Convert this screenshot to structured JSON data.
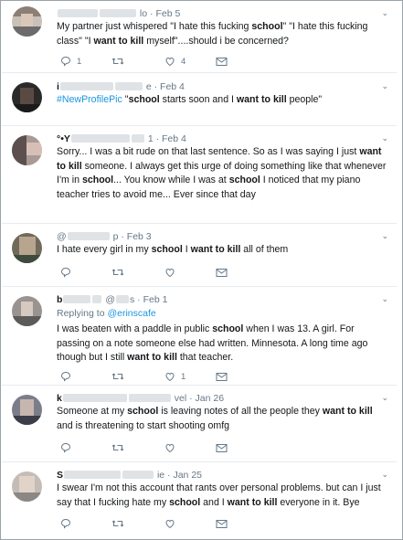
{
  "tweets": [
    {
      "handle_tail": "lo",
      "date": "Feb 5",
      "segments": [
        {
          "t": "My partner just whispered \"I hate this fucking "
        },
        {
          "t": "school",
          "b": true
        },
        {
          "t": "\" \"I hate this fucking class\" \"I "
        },
        {
          "t": "want to kill",
          "b": true
        },
        {
          "t": " myself\"....should i be concerned?"
        }
      ],
      "reply_count": "1",
      "retweet_count": "",
      "like_count": "4"
    },
    {
      "handle_head": "i",
      "handle_tail": "e",
      "date": "Feb 4",
      "segments": [
        {
          "t": "#NewProfilePic",
          "h": true
        },
        {
          "t": " \""
        },
        {
          "t": "school",
          "b": true
        },
        {
          "t": " starts soon and I "
        },
        {
          "t": "want to kill",
          "b": true
        },
        {
          "t": " people\""
        }
      ],
      "reply_count": "",
      "retweet_count": "",
      "like_count": ""
    },
    {
      "handle_head": "°•Y",
      "handle_tail": "1",
      "date": "Feb 4",
      "segments": [
        {
          "t": "Sorry... I was a bit rude on that last sentence. So as I was saying I just "
        },
        {
          "t": "want to kill",
          "b": true
        },
        {
          "t": " someone. I always get this urge of doing something like that whenever I'm in "
        },
        {
          "t": "school",
          "b": true
        },
        {
          "t": "... You know while I was at "
        },
        {
          "t": "school",
          "b": true
        },
        {
          "t": " I noticed that my piano teacher tries to avoid me... Ever since that day"
        }
      ],
      "reply_count": "",
      "retweet_count": "",
      "like_count": ""
    },
    {
      "handle_head": "@",
      "handle_tail": "p",
      "date": "Feb 3",
      "segments": [
        {
          "t": "I hate every girl in my "
        },
        {
          "t": "school",
          "b": true
        },
        {
          "t": " I "
        },
        {
          "t": "want to kill",
          "b": true
        },
        {
          "t": " all of them"
        }
      ],
      "reply_count": "",
      "retweet_count": "",
      "like_count": ""
    },
    {
      "handle_head": "b",
      "handle_mid": "@",
      "handle_tail": "s",
      "date": "Feb 1",
      "replying_label": "Replying to",
      "replying_to": "@erinscafe",
      "segments": [
        {
          "t": "I was beaten with a paddle in public "
        },
        {
          "t": "school",
          "b": true
        },
        {
          "t": " when I was 13. A girl. For passing on a note someone else had written. Minnesota. A long time ago though but I still "
        },
        {
          "t": "want to kill",
          "b": true
        },
        {
          "t": " that teacher."
        }
      ],
      "reply_count": "",
      "retweet_count": "",
      "like_count": "1"
    },
    {
      "handle_head": "k",
      "handle_tail": "vel",
      "date": "Jan 26",
      "segments": [
        {
          "t": "Someone at my "
        },
        {
          "t": "school",
          "b": true
        },
        {
          "t": " is leaving notes of all the people they "
        },
        {
          "t": "want to kill",
          "b": true
        },
        {
          "t": " and is threatening to start shooting omfg"
        }
      ],
      "reply_count": "",
      "retweet_count": "",
      "like_count": ""
    },
    {
      "handle_head": "S",
      "handle_tail": "ie",
      "date": "Jan 25",
      "segments": [
        {
          "t": "I swear I'm not this account that rants over personal problems. but can I just say that I fucking hate my "
        },
        {
          "t": "school",
          "b": true
        },
        {
          "t": " and I "
        },
        {
          "t": "want to kill",
          "b": true
        },
        {
          "t": " everyone in it. Bye"
        }
      ],
      "reply_count": "",
      "retweet_count": "",
      "like_count": ""
    }
  ],
  "icons": {
    "reply": "reply-icon",
    "retweet": "retweet-icon",
    "like": "heart-icon",
    "dm": "envelope-icon",
    "caret": "chevron-down-icon"
  },
  "colors": {
    "link": "#1b95e0",
    "secondary_text": "#657786",
    "divider": "#e6ecf0"
  }
}
